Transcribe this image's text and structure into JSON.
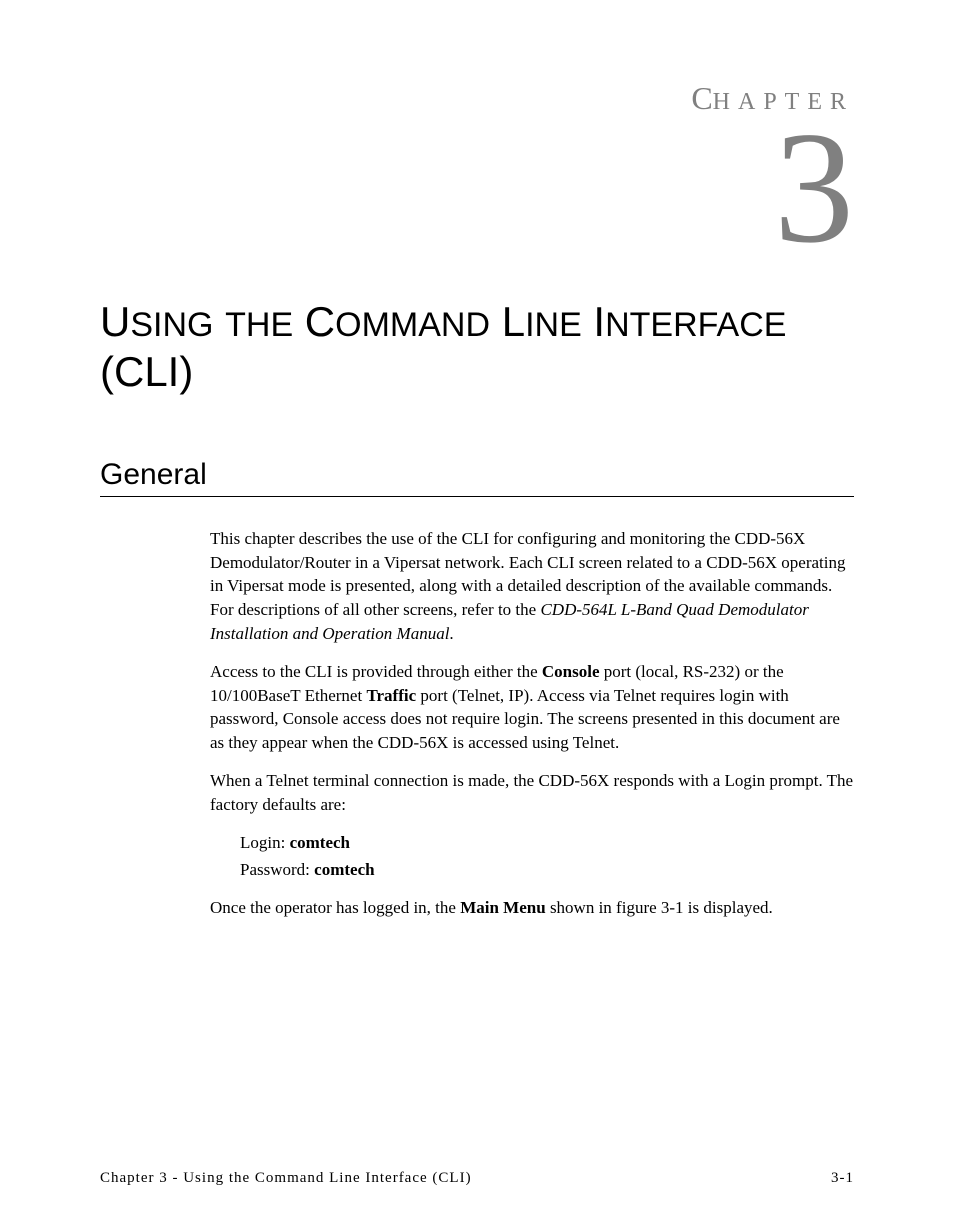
{
  "chapter_label_first": "C",
  "chapter_label_rest": "HAPTER",
  "chapter_number": "3",
  "title_part1": "U",
  "title_part2": "SING",
  "title_part3": " ",
  "title_part4": "THE",
  "title_part5": " C",
  "title_part6": "OMMAND",
  "title_part7": " L",
  "title_part8": "INE",
  "title_part9": " I",
  "title_part10": "NTERFACE",
  "title_line2": "(CLI)",
  "section_heading": "General",
  "para1": "This chapter describes the use of the CLI for configuring and monitoring the CDD-56X Demodulator/Router in a Vipersat network. Each CLI screen related to a CDD-56X operating in Vipersat mode is presented, along with a detailed description of the available commands. For descriptions of all other screens, refer to the ",
  "para1_italic": "CDD-564L L-Band Quad Demodulator Installation and Operation Manual",
  "para1_end": ".",
  "para2_a": "Access to the CLI is provided through either the ",
  "para2_bold1": "Console",
  "para2_b": " port (local, RS-232) or the 10/100BaseT Ethernet ",
  "para2_bold2": "Traffic",
  "para2_c": " port (Telnet, IP). Access via Telnet requires login with password, Console access does not require login. The screens presented in this document are as they appear when the CDD-56X is accessed using Telnet.",
  "para3": "When a Telnet terminal connection is made, the CDD-56X responds with a Login prompt. The factory defaults are:",
  "login_label": "Login: ",
  "login_value": "comtech",
  "password_label": "Password: ",
  "password_value": "comtech",
  "para4_a": "Once the operator has logged in, the ",
  "para4_bold": "Main Menu",
  "para4_b": " shown in figure 3-1 is displayed.",
  "footer_left": "Chapter 3 - Using the Command Line Interface (CLI)",
  "footer_right": "3-1"
}
